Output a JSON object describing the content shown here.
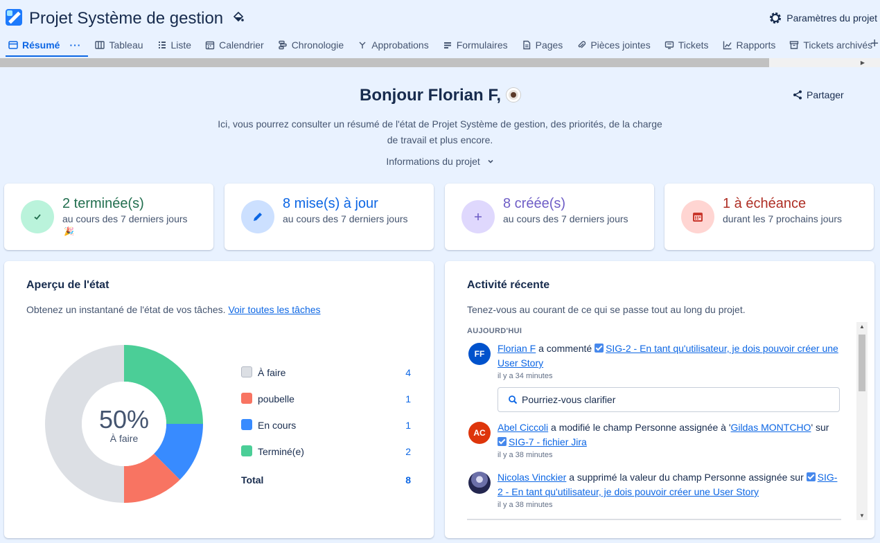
{
  "header": {
    "project_title": "Projet Système de gestion",
    "settings_label": "Paramètres du projet"
  },
  "tabs": [
    {
      "label": "Résumé",
      "icon": "summary-icon",
      "active": true
    },
    {
      "label": "Tableau",
      "icon": "board-icon"
    },
    {
      "label": "Liste",
      "icon": "list-icon"
    },
    {
      "label": "Calendrier",
      "icon": "calendar-icon"
    },
    {
      "label": "Chronologie",
      "icon": "timeline-icon"
    },
    {
      "label": "Approbations",
      "icon": "approvals-icon"
    },
    {
      "label": "Formulaires",
      "icon": "forms-icon"
    },
    {
      "label": "Pages",
      "icon": "pages-icon"
    },
    {
      "label": "Pièces jointes",
      "icon": "attachment-icon"
    },
    {
      "label": "Tickets",
      "icon": "tickets-icon"
    },
    {
      "label": "Rapports",
      "icon": "reports-icon"
    },
    {
      "label": "Tickets archivés",
      "icon": "archive-icon"
    }
  ],
  "tab_more": "···",
  "tab_add": "+",
  "greeting": {
    "title": "Bonjour Florian F,",
    "share_label": "Partager",
    "intro_line1": "Ici, vous pourrez consulter un résumé de l'état de Projet Système de gestion, des priorités, de la charge",
    "intro_line2": "de travail et plus encore.",
    "project_info_label": "Informations du projet"
  },
  "stats": [
    {
      "big": "2 terminée(s)",
      "small": "au cours des 7 derniers jours",
      "extra": "🎉",
      "color": "#216e4e",
      "circle_bg": "#baf3db",
      "icon": "check-icon"
    },
    {
      "big": "8 mise(s) à jour",
      "small": "au cours des 7 derniers jours",
      "color": "#0c66e4",
      "circle_bg": "#cce0ff",
      "icon": "pencil-icon"
    },
    {
      "big": "8 créée(s)",
      "small": "au cours des 7 derniers jours",
      "color": "#6e5dc6",
      "circle_bg": "#dfd8fd",
      "icon": "plus-icon"
    },
    {
      "big": "1 à échéance",
      "small": "durant les 7 prochains jours",
      "color": "#ae2e24",
      "circle_bg": "#ffd5d2",
      "icon": "calendar-due-icon"
    }
  ],
  "status_panel": {
    "title": "Aperçu de l'état",
    "desc": "Obtenez un instantané de l'état de vos tâches.",
    "link": "Voir toutes les tâches",
    "center_value": "50%",
    "center_label": "À faire",
    "total_label": "Total",
    "total_value": "8"
  },
  "chart_data": {
    "type": "pie",
    "categories": [
      "À faire",
      "poubelle",
      "En cours",
      "Terminé(e)"
    ],
    "values": [
      4,
      1,
      1,
      2
    ],
    "colors": [
      "#dcdfe4",
      "#f87462",
      "#388bff",
      "#4bce97"
    ]
  },
  "activity_panel": {
    "title": "Activité récente",
    "desc": "Tenez-vous au courant de ce qui se passe tout au long du projet.",
    "section": "AUJOURD'HUI",
    "items": [
      {
        "avatar": "FF",
        "avatar_color": "#0052cc",
        "user": "Florian F",
        "action": "a commenté",
        "link": "SIG-2 - En tant qu'utilisateur, je dois pouvoir créer une User Story",
        "time": "il y a 34 minutes",
        "comment": "Pourriez-vous clarifier"
      },
      {
        "avatar": "AC",
        "avatar_color": "#de350b",
        "user": "Abel Ciccoli",
        "action": "a modifié le champ Personne assignée à '",
        "target": "Gildas MONTCHO",
        "action2": "' sur",
        "link": "SIG-7 - fichier Jira",
        "time": "il y a 38 minutes"
      },
      {
        "avatar": "",
        "avatar_color": "#3a3f73",
        "user": "Nicolas Vinckier",
        "action": "a supprimé la valeur du champ Personne assignée sur",
        "link": "SIG-2 - En tant qu'utilisateur, je dois pouvoir créer une User Story",
        "time": "il y a 38 minutes"
      }
    ]
  }
}
